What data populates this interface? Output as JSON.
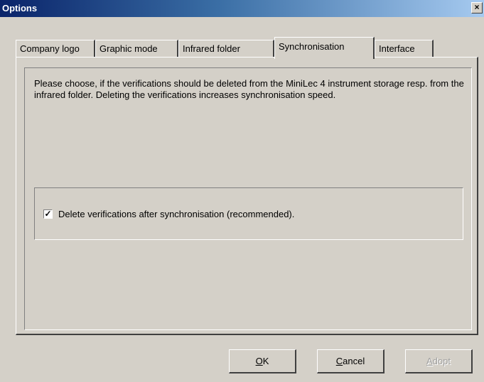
{
  "window": {
    "title": "Options",
    "close_glyph": "×"
  },
  "tabs": [
    {
      "label": "Company logo",
      "active": false
    },
    {
      "label": "Graphic mode",
      "active": false
    },
    {
      "label": "Infrared folder",
      "active": false
    },
    {
      "label": "Synchronisation",
      "active": true
    },
    {
      "label": "Interface",
      "active": false
    }
  ],
  "sync": {
    "description": "Please choose, if the verifications should be deleted from the MiniLec 4 instrument storage resp. from the infrared folder. Deleting the verifications increases synchronisation speed.",
    "delete_checkbox": {
      "checked": true,
      "check_glyph": "✓",
      "label": "Delete verifications after synchronisation (recommended)."
    }
  },
  "buttons": {
    "ok": {
      "mnemonic": "O",
      "rest": "K"
    },
    "cancel": {
      "mnemonic": "C",
      "rest": "ancel"
    },
    "adopt": {
      "mnemonic": "A",
      "rest": "dopt",
      "enabled": false
    }
  },
  "icons": {
    "close": "close-icon",
    "check": "checkmark-icon"
  }
}
